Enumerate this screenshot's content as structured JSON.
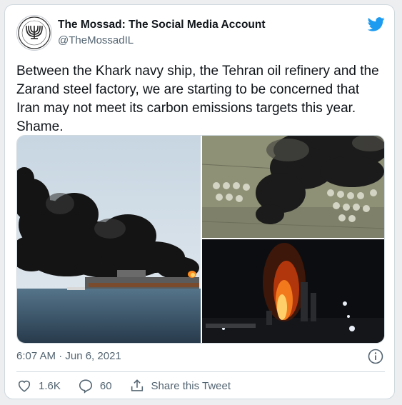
{
  "tweet": {
    "author_name": "The Mossad: The Social Media Account",
    "author_handle": "@TheMossadIL",
    "text": "Between the Khark navy ship, the Tehran oil refinery and the Zarand steel factory, we are starting to be concerned that Iran may not meet its carbon emissions targets this year. Shame.",
    "timestamp": "6:07 AM · Jun 6, 2021",
    "likes": "1.6K",
    "replies": "60",
    "share_label": "Share this Tweet"
  },
  "colors": {
    "twitter_blue": "#1d9bf0",
    "text_primary": "#0f1419",
    "text_secondary": "#536471",
    "border": "#cfd9de"
  },
  "icons": [
    "twitter-bird-icon",
    "info-icon",
    "heart-icon",
    "reply-icon",
    "share-icon"
  ]
}
